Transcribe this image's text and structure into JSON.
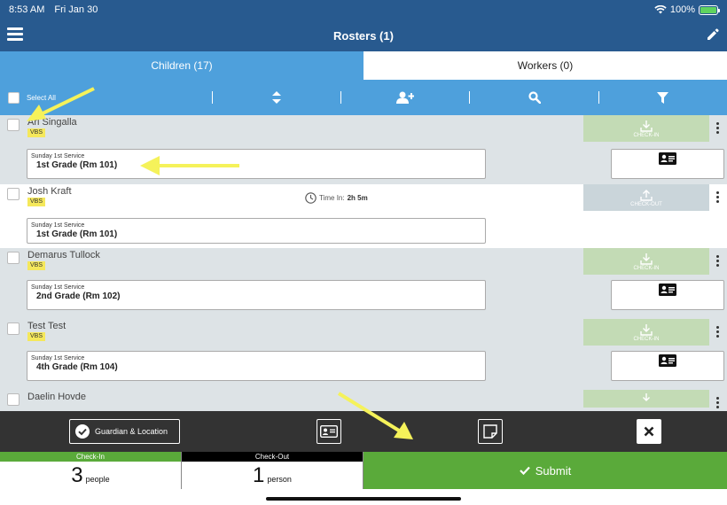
{
  "status_bar": {
    "time": "8:53 AM",
    "date": "Fri Jan 30",
    "battery": "100%"
  },
  "nav": {
    "title": "Rosters (1)"
  },
  "tabs": [
    {
      "label": "Children (17)",
      "active": true
    },
    {
      "label": "Workers (0)",
      "active": false
    }
  ],
  "toolbar": {
    "select_all": "Select All"
  },
  "rows": [
    {
      "name": "Ari Singalla",
      "badge": "VBS",
      "action": "CHECK-IN",
      "service": "Sunday 1st Service",
      "room": "1st Grade  (Rm 101)",
      "time_in_label": "",
      "time_in_value": ""
    },
    {
      "name": "Josh Kraft",
      "badge": "VBS",
      "action": "CHECK-OUT",
      "service": "Sunday 1st Service",
      "room": "1st Grade  (Rm 101)",
      "time_in_label": "Time In:",
      "time_in_value": "2h 5m"
    },
    {
      "name": "Demarus Tullock",
      "badge": "VBS",
      "action": "CHECK-IN",
      "service": "Sunday 1st Service",
      "room": "2nd Grade  (Rm 102)",
      "time_in_label": "",
      "time_in_value": ""
    },
    {
      "name": "Test Test",
      "badge": "VBS",
      "action": "CHECK-IN",
      "service": "Sunday 1st Service",
      "room": "4th Grade  (Rm 104)",
      "time_in_label": "",
      "time_in_value": ""
    },
    {
      "name": "Daelin Hovde",
      "badge": "",
      "action": "",
      "service": "",
      "room": "",
      "time_in_label": "",
      "time_in_value": ""
    }
  ],
  "bottom_bar": {
    "guardian_location": "Guardian & Location"
  },
  "counts": {
    "checkin": {
      "header": "Check-In",
      "number": "3",
      "unit": "people"
    },
    "checkout": {
      "header": "Check-Out",
      "number": "1",
      "unit": "person"
    }
  },
  "submit": {
    "label": "Submit"
  },
  "colors": {
    "nav": "#285a8f",
    "tab_active": "#4ea0dc",
    "checkin": "#5aaa3a",
    "annotation_arrow": "#f5f25a"
  }
}
